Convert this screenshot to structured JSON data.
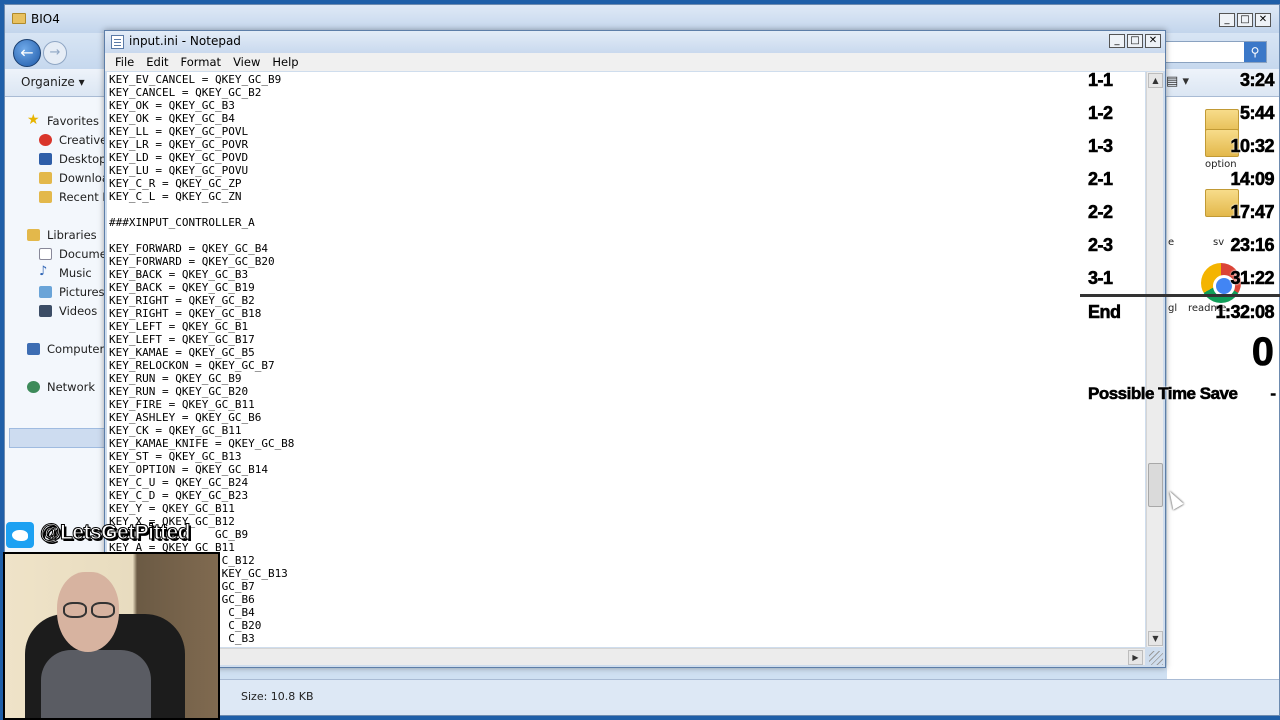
{
  "explorer": {
    "title": "BIO4",
    "organize": "Organize",
    "toolbar_view": "▤ ▾",
    "nav": {
      "favorites": "Favorites",
      "creative": "Creative",
      "desktop": "Desktop",
      "downloads": "Downloa",
      "recent": "Recent P",
      "libraries": "Libraries",
      "documents": "Documer",
      "music": "Music",
      "pictures": "Pictures",
      "videos": "Videos",
      "computer": "Computer",
      "network": "Network"
    },
    "files": {
      "option": "option",
      "e": "e",
      "sv": "sv",
      "gl": "gl",
      "readme": "readme"
    },
    "status_size": "Size: 10.8 KB"
  },
  "notepad": {
    "title": "input.ini - Notepad",
    "menu": [
      "File",
      "Edit",
      "Format",
      "View",
      "Help"
    ],
    "lines": [
      "KEY_EV_CANCEL = QKEY_GC_B9",
      "KEY_CANCEL = QKEY_GC_B2",
      "KEY_OK = QKEY_GC_B3",
      "KEY_OK = QKEY_GC_B4",
      "KEY_LL = QKEY_GC_POVL",
      "KEY_LR = QKEY_GC_POVR",
      "KEY_LD = QKEY_GC_POVD",
      "KEY_LU = QKEY_GC_POVU",
      "KEY_C_R = QKEY_GC_ZP",
      "KEY_C_L = QKEY_GC_ZN",
      "",
      "###XINPUT_CONTROLLER_A",
      "",
      "KEY_FORWARD = QKEY_GC_B4",
      "KEY_FORWARD = QKEY_GC_B20",
      "KEY_BACK = QKEY_GC_B3",
      "KEY_BACK = QKEY_GC_B19",
      "KEY_RIGHT = QKEY_GC_B2",
      "KEY_RIGHT = QKEY_GC_B18",
      "KEY_LEFT = QKEY_GC_B1",
      "KEY_LEFT = QKEY_GC_B17",
      "KEY_KAMAE = QKEY_GC_B5",
      "KEY_RELOCKON = QKEY_GC_B7",
      "KEY_RUN = QKEY_GC_B9",
      "KEY_RUN = QKEY_GC_B20",
      "KEY_FIRE = QKEY_GC_B11",
      "KEY_ASHLEY = QKEY_GC_B6",
      "KEY_CK = QKEY_GC_B11",
      "KEY_KAMAE_KNIFE = QKEY_GC_B8",
      "KEY_ST = QKEY_GC_B13",
      "KEY_OPTION = QKEY_GC_B14",
      "KEY_C_U = QKEY_GC_B24",
      "KEY_C_D = QKEY_GC_B23",
      "KEY_Y = QKEY_GC_B11",
      "KEY_X = QKEY_GC_B12",
      "                GC_B9",
      "KEY_A = QKEY_GC_B11",
      "                 C_B12",
      "                 KEY_GC_B13",
      "                 GC_B7",
      "                 GC_B6",
      "                  C_B4",
      "                  C_B20",
      "                  C_B3"
    ]
  },
  "timer": {
    "splits": [
      {
        "name": "1-1",
        "time": "3:24"
      },
      {
        "name": "1-2",
        "time": "5:44"
      },
      {
        "name": "1-3",
        "time": "10:32"
      },
      {
        "name": "2-1",
        "time": "14:09"
      },
      {
        "name": "2-2",
        "time": "17:47"
      },
      {
        "name": "2-3",
        "time": "23:16"
      },
      {
        "name": "3-1",
        "time": "31:22"
      },
      {
        "name": "End",
        "time": "1:32:08"
      }
    ],
    "main_time": "0",
    "possible_time_save_label": "Possible Time Save",
    "possible_time_save_value": "-"
  },
  "overlay": {
    "handle": "@LetsGetPitted"
  }
}
